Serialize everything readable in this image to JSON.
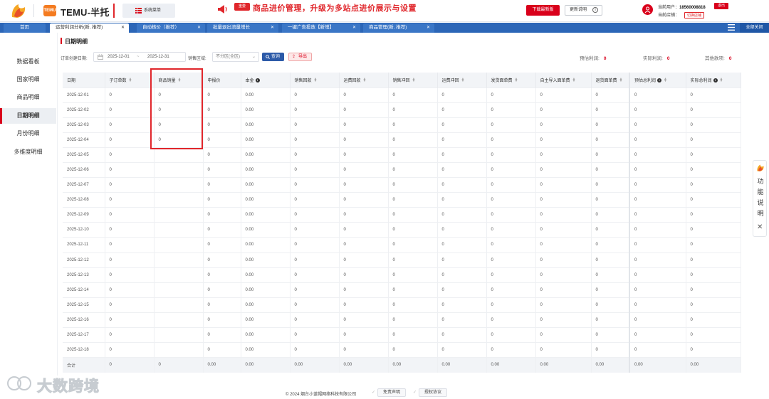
{
  "header": {
    "app_badge": "TEMU",
    "app_title": "TEMU-半托",
    "system_menu_label": "系统菜单",
    "announcement_tag": "重要",
    "announcement_text": "商品进价管理，升级为多站点进价展示与设置",
    "download_button": "下载最新版",
    "update_notes_button": "更新说明",
    "user_label": "当前用户：",
    "user_phone": "18560008818",
    "logout_button": "退出",
    "store_label": "当前店铺：",
    "switch_store_button": "切换店铺"
  },
  "tabs": {
    "home": "首页",
    "items": [
      {
        "label": "运营利润分析(新, 推荐)",
        "active": true
      },
      {
        "label": "自动核价（推荐）",
        "active": false
      },
      {
        "label": "批量退出流量增长",
        "active": false
      },
      {
        "label": "一键广告投放【新增】",
        "active": false
      },
      {
        "label": "商品管理(新, 推荐)",
        "active": false
      }
    ],
    "close_all": "全部关闭"
  },
  "sidebar": {
    "items": [
      {
        "label": "数据看板",
        "active": false
      },
      {
        "label": "国家明细",
        "active": false
      },
      {
        "label": "商品明细",
        "active": false
      },
      {
        "label": "日期明细",
        "active": true
      },
      {
        "label": "月份明细",
        "active": false
      },
      {
        "label": "多维度明细",
        "active": false
      }
    ]
  },
  "main": {
    "section_title": "日期明细",
    "filters": {
      "order_date_label": "订单创建日期:",
      "date_start": "2025-12-01",
      "date_sep": "~",
      "date_end": "2025-12-31",
      "region_label": "销售区域:",
      "region_value": "不分区(全区)",
      "query_button": "查询",
      "export_button": "导出"
    },
    "stats": {
      "estimated_profit_label": "预估利润:",
      "estimated_profit_value": "0",
      "actual_profit_label": "实际利润:",
      "actual_profit_value": "0",
      "other_amount_label": "其他款项:",
      "other_amount_value": "0"
    },
    "table": {
      "columns": [
        "日期",
        "子订单数",
        "商品销量",
        "申报价",
        "本金",
        "销售回款",
        "运费回款",
        "销售冲回",
        "运费冲回",
        "发货面单费",
        "自主导入面单费",
        "退货面单费",
        "预估总利润",
        "实际总利润"
      ],
      "rows": [
        [
          "2025-12-01",
          "0",
          "0",
          "0",
          "0.00",
          "0",
          "0",
          "0",
          "0",
          "0",
          "0",
          "0",
          "0",
          "0"
        ],
        [
          "2025-12-02",
          "0",
          "0",
          "0",
          "0.00",
          "0",
          "0",
          "0",
          "0",
          "0",
          "0",
          "0",
          "0",
          "0"
        ],
        [
          "2025-12-03",
          "0",
          "0",
          "0",
          "0.00",
          "0",
          "0",
          "0",
          "0",
          "0",
          "0",
          "0",
          "0",
          "0"
        ],
        [
          "2025-12-04",
          "0",
          "0",
          "0",
          "0.00",
          "0",
          "0",
          "0",
          "0",
          "0",
          "0",
          "0",
          "0",
          "0"
        ],
        [
          "2025-12-05",
          "0",
          "",
          "0",
          "0.00",
          "0",
          "0",
          "0",
          "0",
          "0",
          "0",
          "0",
          "0",
          "0"
        ],
        [
          "2025-12-06",
          "0",
          "",
          "0",
          "0.00",
          "0",
          "0",
          "0",
          "0",
          "0",
          "0",
          "0",
          "0",
          "0"
        ],
        [
          "2025-12-07",
          "0",
          "",
          "0",
          "0.00",
          "0",
          "0",
          "0",
          "0",
          "0",
          "0",
          "0",
          "0",
          "0"
        ],
        [
          "2025-12-08",
          "0",
          "",
          "0",
          "0.00",
          "0",
          "0",
          "0",
          "0",
          "0",
          "0",
          "0",
          "0",
          "0"
        ],
        [
          "2025-12-09",
          "0",
          "",
          "0",
          "0.00",
          "0",
          "0",
          "0",
          "0",
          "0",
          "0",
          "0",
          "0",
          "0"
        ],
        [
          "2025-12-10",
          "0",
          "",
          "0",
          "0.00",
          "0",
          "0",
          "0",
          "0",
          "0",
          "0",
          "0",
          "0",
          "0"
        ],
        [
          "2025-12-11",
          "0",
          "",
          "0",
          "0.00",
          "0",
          "0",
          "0",
          "0",
          "0",
          "0",
          "0",
          "0",
          "0"
        ],
        [
          "2025-12-12",
          "0",
          "",
          "0",
          "0.00",
          "0",
          "0",
          "0",
          "0",
          "0",
          "0",
          "0",
          "0",
          "0"
        ],
        [
          "2025-12-13",
          "0",
          "",
          "0",
          "0.00",
          "0",
          "0",
          "0",
          "0",
          "0",
          "0",
          "0",
          "0",
          "0"
        ],
        [
          "2025-12-14",
          "0",
          "",
          "0",
          "0.00",
          "0",
          "0",
          "0",
          "0",
          "0",
          "0",
          "0",
          "0",
          "0"
        ],
        [
          "2025-12-15",
          "0",
          "",
          "0",
          "0.00",
          "0",
          "0",
          "0",
          "0",
          "0",
          "0",
          "0",
          "0",
          "0"
        ],
        [
          "2025-12-16",
          "0",
          "",
          "0",
          "0.00",
          "0",
          "0",
          "0",
          "0",
          "0",
          "0",
          "0",
          "0",
          "0"
        ],
        [
          "2025-12-17",
          "0",
          "",
          "0",
          "0.00",
          "0",
          "0",
          "0",
          "0",
          "0",
          "0",
          "0",
          "0",
          "0"
        ],
        [
          "2025-12-18",
          "0",
          "",
          "0",
          "0.00",
          "0",
          "0",
          "0",
          "0",
          "0",
          "0",
          "0",
          "0",
          "0"
        ]
      ],
      "total_row": [
        "合计",
        "0",
        "0",
        "0.00",
        "0.00",
        "0.00",
        "0.00",
        "0.00",
        "0.00",
        "0.00",
        "0.00",
        "0.00",
        "0.00",
        "0.00"
      ]
    }
  },
  "feature_panel": {
    "text": "功能说明"
  },
  "footer": {
    "copyright": "© 2024 烟台小蓝帽网络科技有限公司",
    "disclaimer_button": "免责声明",
    "license_button": "授权协议"
  },
  "watermark": {
    "text": "大数跨境"
  },
  "colors": {
    "brand_red": "#d9001b",
    "tab_bar_blue": "#2c66b7",
    "query_blue": "#2c5aa8",
    "header_gray": "#f2f4f7"
  }
}
